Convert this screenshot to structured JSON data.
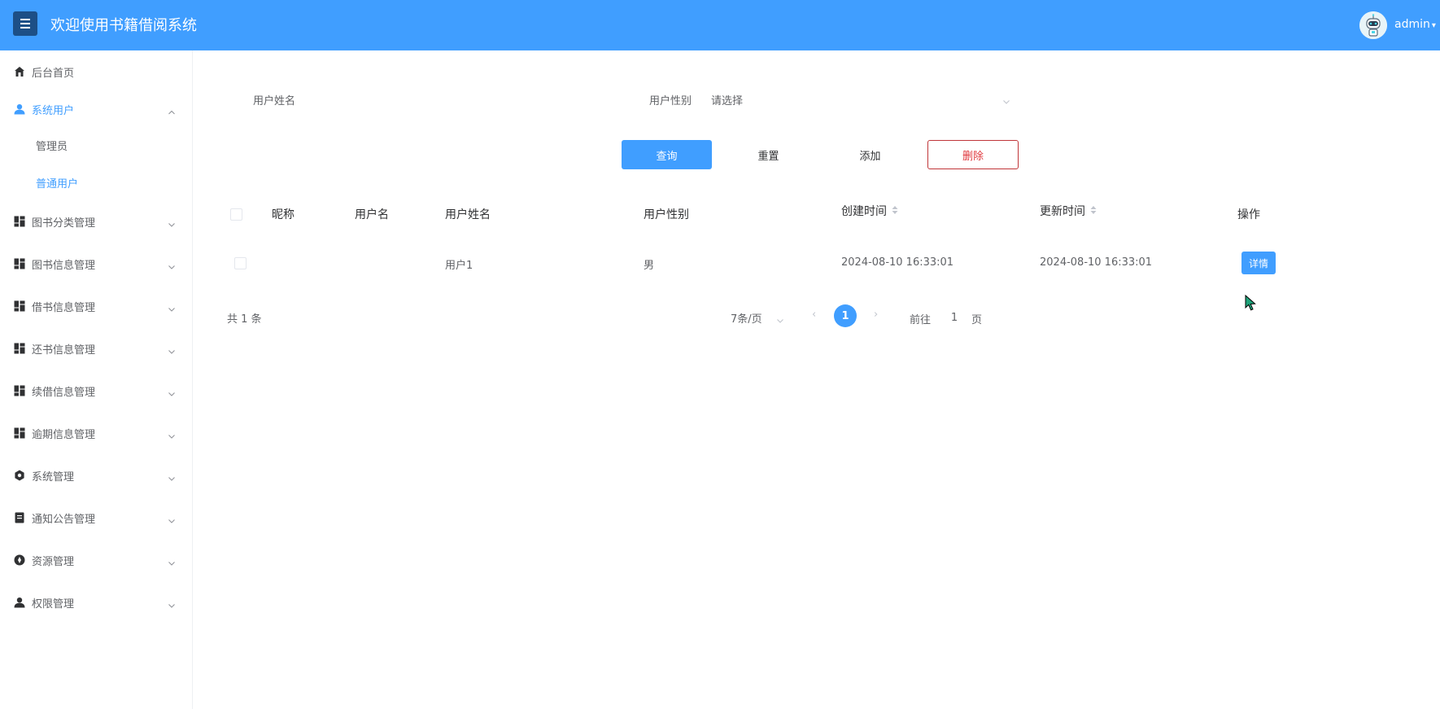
{
  "header": {
    "title": "欢迎使用书籍借阅系统",
    "user": "admin",
    "menu_icon": "hamburger-icon",
    "avatar_icon": "robot-avatar"
  },
  "sidebar": {
    "items": [
      {
        "label": "后台首页",
        "icon": "home-icon"
      },
      {
        "label": "系统用户",
        "icon": "user-icon",
        "expanded": true,
        "children": [
          {
            "label": "管理员"
          },
          {
            "label": "普通用户",
            "current": true
          }
        ]
      },
      {
        "label": "图书分类管理",
        "icon": "grid-icon"
      },
      {
        "label": "图书信息管理",
        "icon": "grid-icon"
      },
      {
        "label": "借书信息管理",
        "icon": "grid-icon"
      },
      {
        "label": "还书信息管理",
        "icon": "grid-icon"
      },
      {
        "label": "续借信息管理",
        "icon": "grid-icon"
      },
      {
        "label": "逾期信息管理",
        "icon": "grid-icon"
      },
      {
        "label": "系统管理",
        "icon": "gear-icon"
      },
      {
        "label": "通知公告管理",
        "icon": "notice-icon"
      },
      {
        "label": "资源管理",
        "icon": "compass-icon"
      },
      {
        "label": "权限管理",
        "icon": "user-icon"
      }
    ]
  },
  "search": {
    "name_label": "用户姓名",
    "name_value": "",
    "gender_label": "用户性别",
    "gender_placeholder": "请选择"
  },
  "buttons": {
    "query": "查询",
    "reset": "重置",
    "add": "添加",
    "delete": "删除"
  },
  "table": {
    "columns": [
      "昵称",
      "用户名",
      "用户姓名",
      "用户性别",
      "创建时间",
      "更新时间",
      "操作"
    ],
    "rows": [
      {
        "nickname": "",
        "username": "",
        "real_name": "用户1",
        "gender": "男",
        "created": "2024-08-10 16:33:01",
        "updated": "2024-08-10 16:33:01",
        "action": "详情"
      }
    ]
  },
  "pagination": {
    "total": "共 1 条",
    "page_size": "7条/页",
    "current": "1",
    "goto_prefix": "前往",
    "goto_value": "1",
    "goto_suffix": "页"
  },
  "colors": {
    "primary": "#409eff",
    "danger": "#e0393e",
    "menu_toggle": "#1d4f86"
  }
}
